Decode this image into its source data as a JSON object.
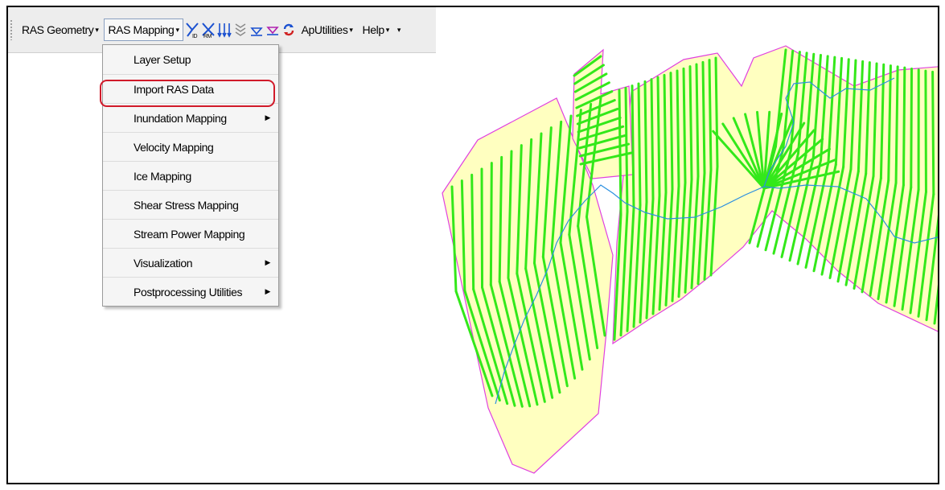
{
  "toolbar": {
    "ras_geometry_label": "RAS Geometry",
    "ras_mapping_label": "RAS Mapping",
    "aputilities_label": "ApUtilities",
    "help_label": "Help",
    "icon_xs_id_label": "ID",
    "icon_xs_rm_label": "RM"
  },
  "ras_mapping_menu": {
    "items": [
      {
        "label": "Layer Setup",
        "submenu": false
      },
      {
        "label": "Import RAS Data",
        "submenu": false
      },
      {
        "label": "Inundation Mapping",
        "submenu": true
      },
      {
        "label": "Velocity Mapping",
        "submenu": false
      },
      {
        "label": "Ice Mapping",
        "submenu": false
      },
      {
        "label": "Shear Stress Mapping",
        "submenu": false
      },
      {
        "label": "Stream Power Mapping",
        "submenu": false
      },
      {
        "label": "Visualization",
        "submenu": true
      },
      {
        "label": "Postprocessing Utilities",
        "submenu": true
      }
    ],
    "highlighted_item": "Import RAS Data"
  },
  "icons": [
    "grip-icon",
    "xs-cut-id-icon",
    "xs-cut-rm-icon",
    "flowpath-icon",
    "bankline-icon",
    "water-surface-icon",
    "water-surface-alt-icon",
    "refresh-icon"
  ],
  "colors": {
    "floodplain_fill": "#ffffc0",
    "cross_section": "#33e81a",
    "stream_centerline": "#2a8fe0",
    "boundary": "#e040e0",
    "highlight": "#d11a2a"
  }
}
